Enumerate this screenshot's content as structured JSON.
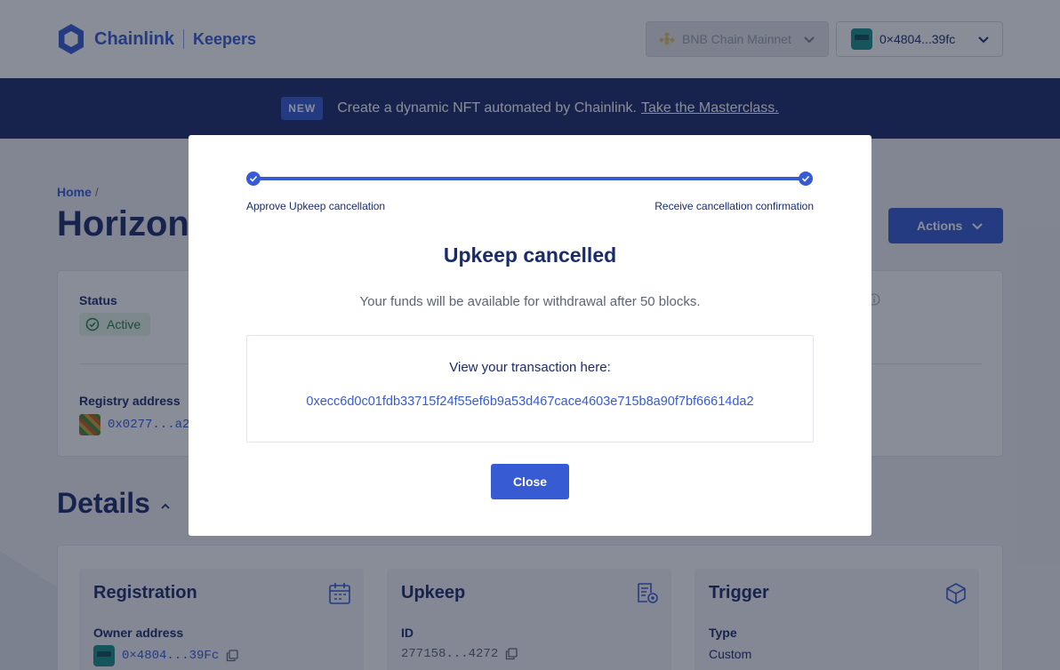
{
  "header": {
    "brand": "Chainlink",
    "product": "Keepers",
    "network": "BNB Chain Mainnet",
    "wallet": "0×4804...39fc"
  },
  "banner": {
    "badge": "NEW",
    "text": "Create a dynamic NFT automated by Chainlink.",
    "link": "Take the Masterclass."
  },
  "page": {
    "breadcrumb_home": "Home",
    "breadcrumb_sep": "/",
    "title": "Horizon",
    "actions_label": "Actions"
  },
  "status_card": {
    "status_label": "Status",
    "status_value": "Active",
    "registry_label": "Registry address",
    "registry_value": "0x0277...a2"
  },
  "details": {
    "title": "Details",
    "registration": {
      "title": "Registration",
      "owner_label": "Owner address",
      "owner_value": "0×4804...39Fc"
    },
    "upkeep": {
      "title": "Upkeep",
      "id_label": "ID",
      "id_value": "277158...4272"
    },
    "trigger": {
      "title": "Trigger",
      "type_label": "Type",
      "type_value": "Custom"
    }
  },
  "modal": {
    "step1": "Approve Upkeep cancellation",
    "step2": "Receive cancellation confirmation",
    "title": "Upkeep cancelled",
    "subtitle": "Your funds will be available for withdrawal after 50 blocks.",
    "tx_label": "View your transaction here:",
    "tx_hash": "0xecc6d0c01fdb33715f24f55ef6b9a53d467cace4603e715b8a90f7bf66614da2",
    "close_label": "Close"
  },
  "colors": {
    "brand_blue": "#375bd2",
    "navy": "#1a2b6b",
    "success_green": "#217a3f"
  }
}
